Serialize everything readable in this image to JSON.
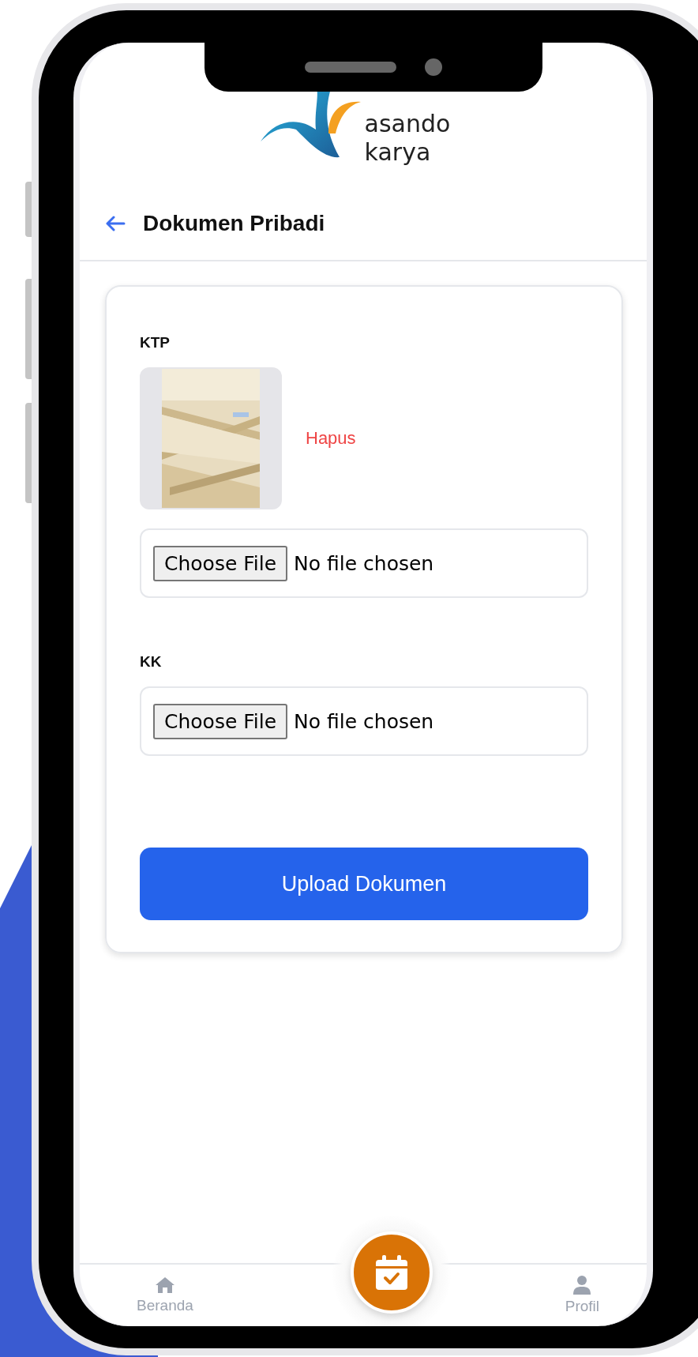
{
  "logo": {
    "lines": [
      "asando",
      "karya"
    ]
  },
  "header": {
    "title": "Dokumen Pribadi"
  },
  "documents": [
    {
      "label": "KTP",
      "delete_label": "Hapus",
      "file_button": "Choose File",
      "file_status": "No file chosen"
    },
    {
      "label": "KK",
      "file_button": "Choose File",
      "file_status": "No file chosen"
    }
  ],
  "submit": "Upload Dokumen",
  "bottom_nav": [
    {
      "kind": "home",
      "label": "Beranda"
    },
    {
      "kind": "calendar"
    },
    {
      "kind": "profile",
      "label": "Profil"
    }
  ]
}
